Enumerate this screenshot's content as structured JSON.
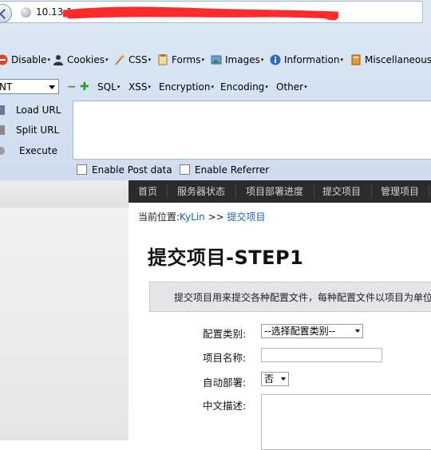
{
  "browser": {
    "url_visible": "10.13.1"
  },
  "hackbar": {
    "menu": [
      {
        "label": "Disable",
        "icon": "disable-icon"
      },
      {
        "label": "Cookies",
        "icon": "cookies-icon"
      },
      {
        "label": "CSS",
        "icon": "css-icon"
      },
      {
        "label": "Forms",
        "icon": "forms-icon"
      },
      {
        "label": "Images",
        "icon": "images-icon"
      },
      {
        "label": "Information",
        "icon": "information-icon"
      },
      {
        "label": "Miscellaneous",
        "icon": "miscellaneous-icon"
      }
    ],
    "type_select": "NT",
    "menu2": [
      "SQL",
      "XSS",
      "Encryption",
      "Encoding",
      "Other"
    ],
    "load_url": "Load URL",
    "split_url": "Split URL",
    "execute": "Execute",
    "enable_post": "Enable Post data",
    "enable_referrer": "Enable Referrer"
  },
  "site": {
    "nav": [
      "首页",
      "服务器状态",
      "项目部署进度",
      "提交项目",
      "管理项目"
    ],
    "breadcrumb_prefix": "当前位置:",
    "breadcrumb_home": "KyLin",
    "breadcrumb_sep": " >> ",
    "breadcrumb_current": "提交项目",
    "title": "提交项目-STEP1",
    "info": "提交项目用来提交各种配置文件，每种配置文件以项目为单位",
    "form": {
      "config_type_label": "配置类别:",
      "config_type_value": "--选择配置类别--",
      "project_name_label": "项目名称:",
      "auto_deploy_label": "自动部署:",
      "auto_deploy_value": "否",
      "description_label": "中文描述:"
    }
  },
  "colors": {
    "navbar": "#2b2b2b",
    "link": "#1f5fa8",
    "redaction": "#ff2a2a"
  }
}
